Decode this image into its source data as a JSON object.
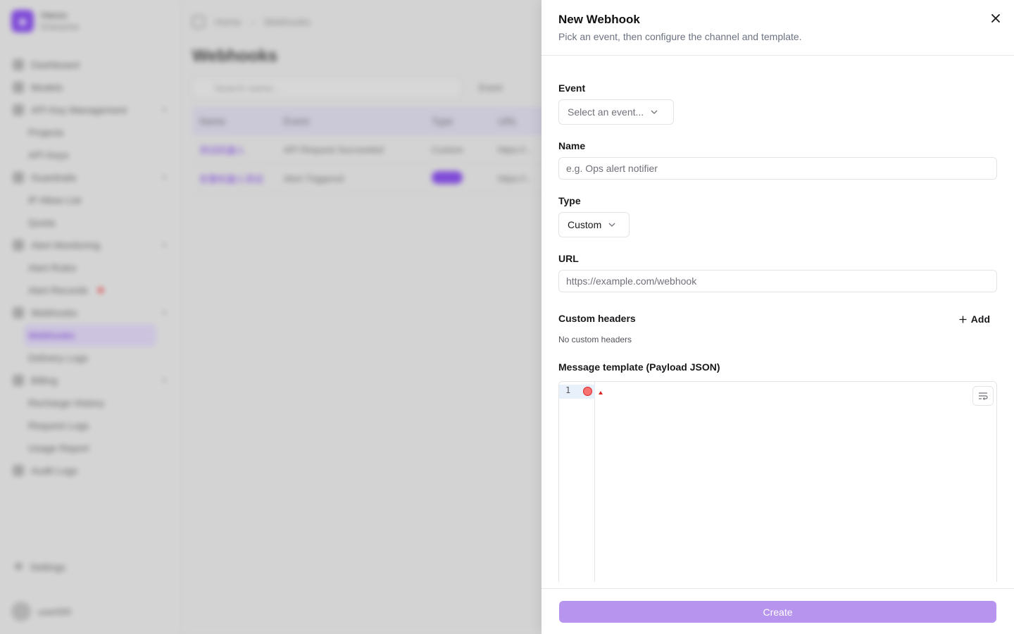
{
  "background": {
    "brand": {
      "name": "Hanzo",
      "plan": "Enterprise"
    },
    "nav": [
      {
        "label": "Dashboard",
        "level": 0
      },
      {
        "label": "Models",
        "level": 0
      },
      {
        "label": "API Key Management",
        "level": 0,
        "expandable": true
      },
      {
        "label": "Projects",
        "level": 1
      },
      {
        "label": "API Keys",
        "level": 1
      },
      {
        "label": "Guardrails",
        "level": 0,
        "expandable": true
      },
      {
        "label": "IP Allow List",
        "level": 1
      },
      {
        "label": "Quota",
        "level": 1
      },
      {
        "label": "Alert Monitoring",
        "level": 0,
        "expandable": true
      },
      {
        "label": "Alert Rules",
        "level": 1
      },
      {
        "label": "Alert Records",
        "level": 1,
        "badge": true
      },
      {
        "label": "Webhooks",
        "level": 0,
        "expandable": true
      },
      {
        "label": "Webhooks",
        "level": 1,
        "active": true
      },
      {
        "label": "Delivery Logs",
        "level": 1
      },
      {
        "label": "Billing",
        "level": 0,
        "expandable": true
      },
      {
        "label": "Recharge History",
        "level": 1
      },
      {
        "label": "Request Logs",
        "level": 1
      },
      {
        "label": "Usage Report",
        "level": 1
      },
      {
        "label": "Audit Logs",
        "level": 0
      }
    ],
    "settings_label": "Settings",
    "user_name": "user000",
    "breadcrumb": {
      "home": "Home",
      "current": "Webhooks"
    },
    "page_title": "Webhooks",
    "search_placeholder": "Search name...",
    "filter_label": "Event",
    "table": {
      "headers": [
        "Name",
        "Event",
        "Type",
        "URL"
      ],
      "rows": [
        {
          "name": "测试机器人",
          "event": "API Request Succeeded",
          "type": "Custom",
          "url": "https://..."
        },
        {
          "name": "告警机器人测试",
          "event": "Alert Triggered",
          "type": "",
          "url": "https://..."
        }
      ]
    }
  },
  "drawer": {
    "title": "New Webhook",
    "description": "Pick an event, then configure the channel and template.",
    "event": {
      "label": "Event",
      "placeholder": "Select an event..."
    },
    "name": {
      "label": "Name",
      "placeholder": "e.g. Ops alert notifier"
    },
    "type": {
      "label": "Type",
      "value": "Custom"
    },
    "url": {
      "label": "URL",
      "placeholder": "https://example.com/webhook"
    },
    "headers": {
      "label": "Custom headers",
      "add_label": "Add",
      "empty_text": "No custom headers"
    },
    "template": {
      "label": "Message template (Payload JSON)",
      "line_number": "1"
    },
    "submit_label": "Create",
    "colors": {
      "primary_disabled": "#b794ee",
      "error": "#dc2626"
    }
  }
}
